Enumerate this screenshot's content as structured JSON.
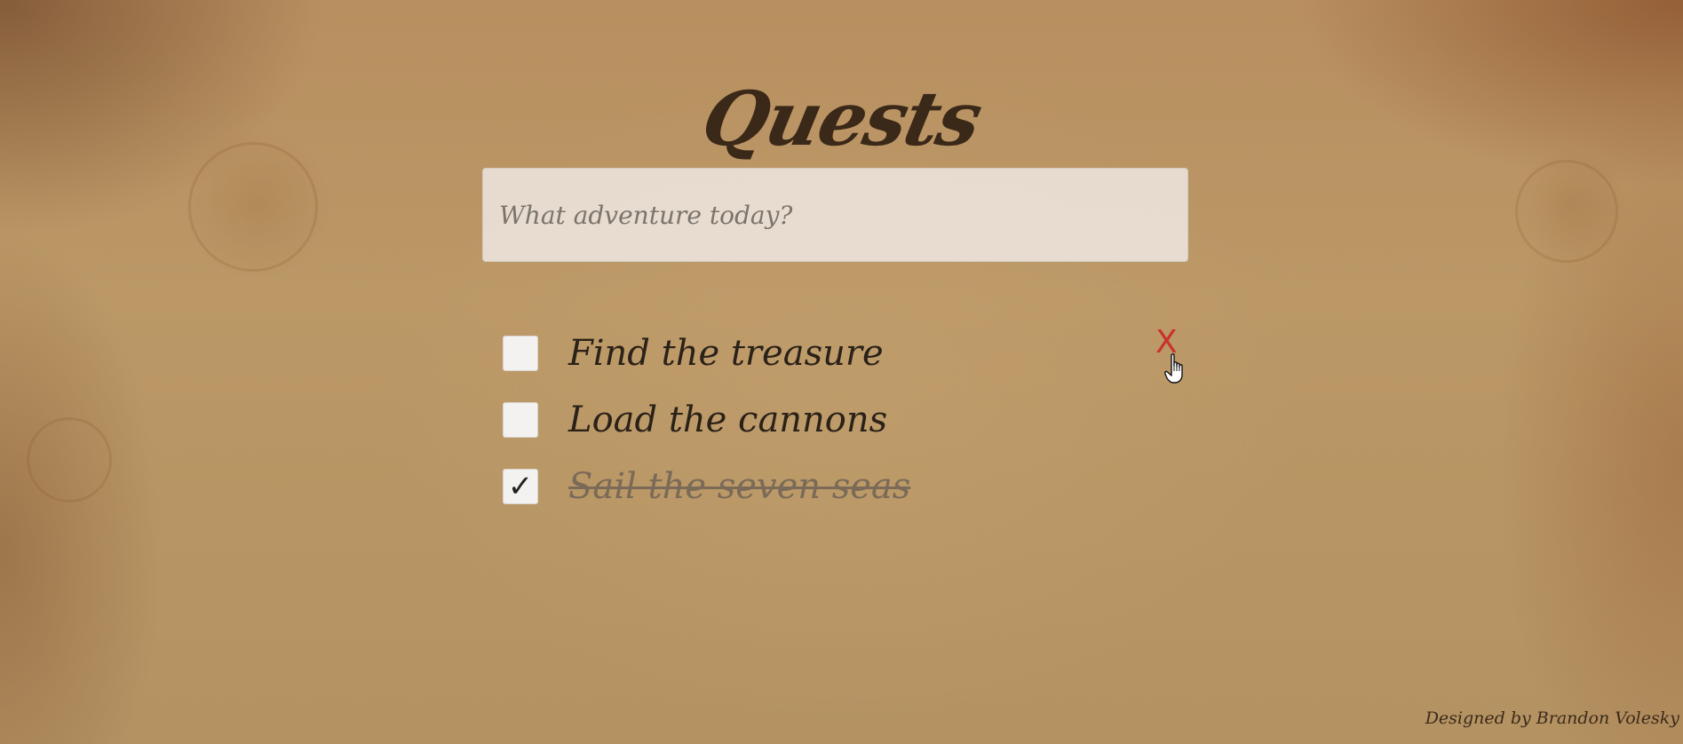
{
  "app": {
    "title": "Quests"
  },
  "new_quest": {
    "placeholder": "What adventure today?",
    "value": ""
  },
  "quests": [
    {
      "label": "Find the treasure",
      "completed": false,
      "check_glyph": ""
    },
    {
      "label": "Load the cannons",
      "completed": false,
      "check_glyph": ""
    },
    {
      "label": "Sail the seven seas",
      "completed": true,
      "check_glyph": "✓"
    }
  ],
  "remove_button": {
    "label": "X",
    "visible_on_quest_index": 0
  },
  "footer": {
    "credit": "Designed by Brandon Volesky"
  },
  "colors": {
    "title": "#3a2818",
    "remove": "#c8332d",
    "completed_text": "#7a6a57"
  },
  "icons": {
    "cursor": "hand-pointer-icon",
    "check": "checkmark-icon",
    "remove": "close-icon"
  }
}
